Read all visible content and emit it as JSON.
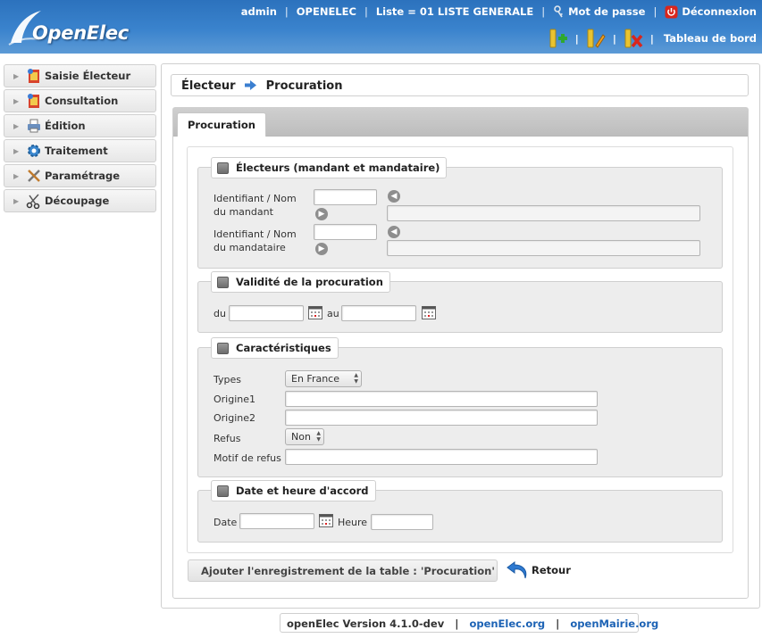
{
  "header": {
    "logo_text": "OpenElec",
    "user": "admin",
    "collectivite": "OPENELEC",
    "liste": "Liste = 01 LISTE GENERALE",
    "password_link": "Mot de passe",
    "logout_link": "Déconnexion",
    "dashboard_link": "Tableau de bord",
    "separator": "|",
    "toolbar_icons": [
      "add-elector-icon",
      "edit-elector-icon",
      "delete-elector-icon"
    ]
  },
  "sidebar": {
    "items": [
      {
        "label": "Saisie Électeur",
        "icon": "saisie-icon"
      },
      {
        "label": "Consultation",
        "icon": "consultation-icon"
      },
      {
        "label": "Édition",
        "icon": "printer-icon"
      },
      {
        "label": "Traitement",
        "icon": "gear-icon"
      },
      {
        "label": "Paramétrage",
        "icon": "tools-icon"
      },
      {
        "label": "Découpage",
        "icon": "scissors-icon"
      }
    ]
  },
  "breadcrumb": {
    "parent": "Électeur",
    "current": "Procuration"
  },
  "tab": {
    "label": "Procuration"
  },
  "form": {
    "electeurs": {
      "legend": "Électeurs (mandant et mandataire)",
      "mandant_label_1": "Identifiant / Nom",
      "mandant_label_2": "du mandant",
      "mandataire_label_1": "Identifiant / Nom",
      "mandataire_label_2": "du mandataire"
    },
    "validite": {
      "legend": "Validité de la procuration",
      "du": "du",
      "au": "au"
    },
    "caracteristiques": {
      "legend": "Caractéristiques",
      "types_label": "Types",
      "types_value": "En France",
      "origine1_label": "Origine1",
      "origine2_label": "Origine2",
      "refus_label": "Refus",
      "refus_value": "Non",
      "motif_label": "Motif de refus"
    },
    "accord": {
      "legend": "Date et heure d'accord",
      "date_label": "Date",
      "heure_label": "Heure"
    }
  },
  "actions": {
    "submit": "Ajouter l'enregistrement de la table : 'Procuration'",
    "back": "Retour"
  },
  "footer": {
    "version": "openElec Version 4.1.0-dev",
    "link1": "openElec.org",
    "link2": "openMairie.org",
    "separator": "|"
  }
}
